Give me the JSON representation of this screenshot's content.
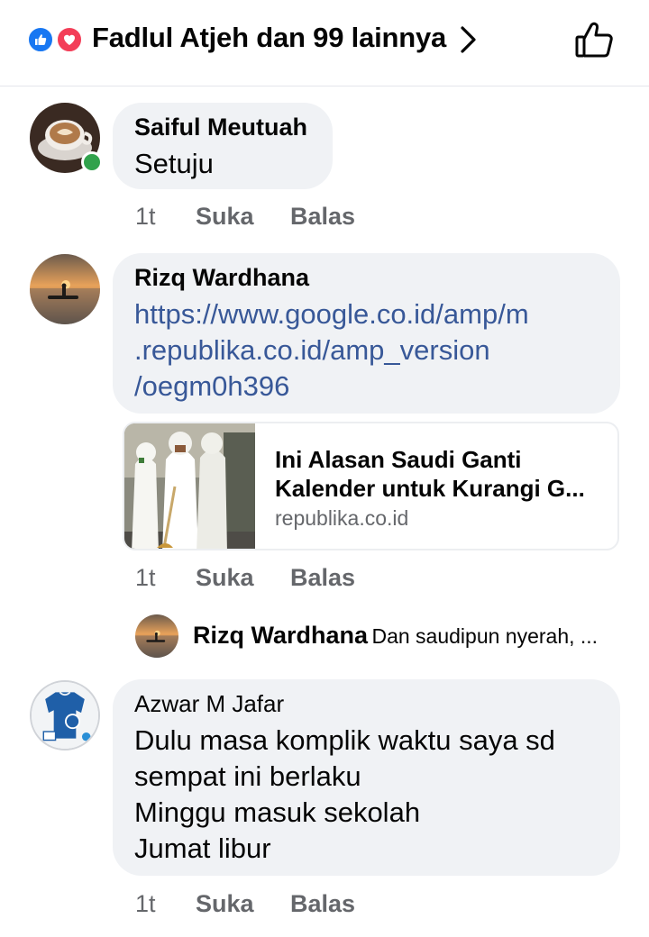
{
  "header": {
    "title": "Fadlul Atjeh dan 99 lainnya",
    "reactions": [
      "like-reaction",
      "love-reaction"
    ],
    "icons": {
      "chevron": "chevron-right-icon",
      "like": "thumbs-up-outline-icon"
    }
  },
  "comments": [
    {
      "author": "Saiful Meutuah",
      "lines": [
        "Setuju"
      ],
      "online": true,
      "avatar": "coffee-cup-photo",
      "actions": {
        "time": "1t",
        "like": "Suka",
        "reply": "Balas"
      }
    },
    {
      "author": "Rizq Wardhana",
      "lines": [
        "https://www.google.co.id/amp/m",
        ".republika.co.id/amp_version",
        "/oegm0h396"
      ],
      "avatar": "sunset-boat-photo",
      "link_preview": {
        "title_line1": "Ini Alasan Saudi Ganti",
        "title_line2": "Kalender untuk Kurangi G...",
        "domain": "republika.co.id"
      },
      "actions": {
        "time": "1t",
        "like": "Suka",
        "reply": "Balas"
      },
      "reply_preview": {
        "author": "Rizq Wardhana",
        "text": "Dan saudipun nyerah, ..."
      }
    },
    {
      "author": "Azwar M Jafar",
      "lines": [
        "Dulu masa komplik waktu saya sd",
        "sempat ini berlaku",
        "Minggu masuk sekolah",
        "Jumat libur"
      ],
      "avatar": "blue-shirt-logo",
      "actions": {
        "time": "1t",
        "like": "Suka",
        "reply": "Balas"
      }
    }
  ],
  "colors": {
    "bubble": "#f0f2f5",
    "link": "#385898",
    "muted": "#65676b",
    "like_blue": "#1877f2",
    "love_red": "#f33e58",
    "online_green": "#31a24c"
  }
}
